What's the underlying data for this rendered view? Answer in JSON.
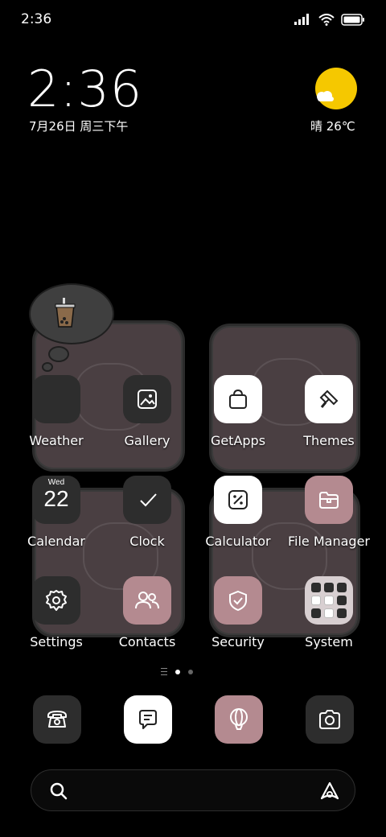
{
  "status_bar": {
    "time": "2:36",
    "icons": [
      "signal-icon",
      "wifi-icon",
      "battery-icon"
    ]
  },
  "clock_widget": {
    "time": "2:36",
    "date": "7月26日 周三下午"
  },
  "weather_widget": {
    "text": "晴 26℃",
    "icon": "sunny-cloud-icon",
    "sun_color": "#f5c800"
  },
  "apps": [
    {
      "label": "Weather",
      "icon": "weather-icon",
      "style": "dark"
    },
    {
      "label": "Gallery",
      "icon": "gallery-icon",
      "style": "dark"
    },
    {
      "label": "GetApps",
      "icon": "shopping-bag-icon",
      "style": "white"
    },
    {
      "label": "Themes",
      "icon": "paintbrush-icon",
      "style": "white"
    },
    {
      "label": "Calendar",
      "icon": "calendar-icon",
      "style": "dark",
      "day": "Wed",
      "date": "22"
    },
    {
      "label": "Clock",
      "icon": "clock-icon",
      "style": "dark"
    },
    {
      "label": "Calculator",
      "icon": "calculator-icon",
      "style": "white"
    },
    {
      "label": "File Manager",
      "icon": "folder-icon",
      "style": "pink"
    },
    {
      "label": "Settings",
      "icon": "gear-icon",
      "style": "dark"
    },
    {
      "label": "Contacts",
      "icon": "contacts-icon",
      "style": "pink"
    },
    {
      "label": "Security",
      "icon": "shield-icon",
      "style": "pink"
    },
    {
      "label": "System",
      "icon": "folder-grid-icon",
      "style": "folder"
    }
  ],
  "page_indicator": {
    "pages": 2,
    "active": 1
  },
  "dock": [
    {
      "icon": "phone-icon",
      "style": "dark"
    },
    {
      "icon": "message-icon",
      "style": "white"
    },
    {
      "icon": "browser-icon",
      "style": "pink"
    },
    {
      "icon": "camera-icon",
      "style": "dark"
    }
  ],
  "search": {
    "icon": "search-icon",
    "assistant_icon": "assistant-icon"
  },
  "colors": {
    "background": "#000000",
    "tile_dark": "#2d2d2d",
    "tile_pink": "#b48a90",
    "tile_white": "#ffffff",
    "sticker": "#4a3f42"
  }
}
